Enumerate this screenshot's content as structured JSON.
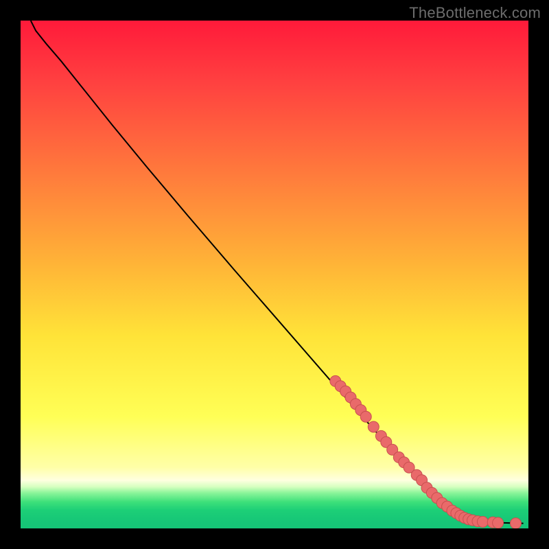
{
  "watermark": "TheBottleneck.com",
  "chart_data": {
    "type": "line",
    "xlim": [
      0,
      100
    ],
    "ylim": [
      0,
      100
    ],
    "grid": false,
    "legend": false,
    "title": "",
    "xlabel": "",
    "ylabel": "",
    "background_gradient_stops": [
      {
        "pos": 0.0,
        "color": "#ff1a3a"
      },
      {
        "pos": 0.12,
        "color": "#ff4040"
      },
      {
        "pos": 0.3,
        "color": "#ff7a3c"
      },
      {
        "pos": 0.48,
        "color": "#ffb437"
      },
      {
        "pos": 0.62,
        "color": "#ffe338"
      },
      {
        "pos": 0.78,
        "color": "#ffff56"
      },
      {
        "pos": 0.88,
        "color": "#ffffa8"
      },
      {
        "pos": 0.905,
        "color": "#ffffe0"
      },
      {
        "pos": 0.918,
        "color": "#d6ffc0"
      },
      {
        "pos": 0.93,
        "color": "#8cf59a"
      },
      {
        "pos": 0.948,
        "color": "#3de07a"
      },
      {
        "pos": 0.964,
        "color": "#1dcf77"
      },
      {
        "pos": 0.982,
        "color": "#17c877"
      },
      {
        "pos": 1.0,
        "color": "#15c577"
      }
    ],
    "curve": [
      {
        "x": 2.0,
        "y": 100.0
      },
      {
        "x": 3.0,
        "y": 98.0
      },
      {
        "x": 5.0,
        "y": 95.5
      },
      {
        "x": 8.0,
        "y": 92.0
      },
      {
        "x": 12.0,
        "y": 87.0
      },
      {
        "x": 18.0,
        "y": 79.5
      },
      {
        "x": 25.0,
        "y": 71.0
      },
      {
        "x": 33.0,
        "y": 61.5
      },
      {
        "x": 42.0,
        "y": 51.0
      },
      {
        "x": 52.0,
        "y": 39.5
      },
      {
        "x": 62.0,
        "y": 28.0
      },
      {
        "x": 70.0,
        "y": 19.0
      },
      {
        "x": 76.0,
        "y": 12.5
      },
      {
        "x": 80.0,
        "y": 8.5
      },
      {
        "x": 83.0,
        "y": 5.5
      },
      {
        "x": 85.5,
        "y": 3.5
      },
      {
        "x": 87.5,
        "y": 2.2
      },
      {
        "x": 89.5,
        "y": 1.5
      },
      {
        "x": 92.0,
        "y": 1.2
      },
      {
        "x": 95.0,
        "y": 1.1
      },
      {
        "x": 99.0,
        "y": 1.0
      }
    ],
    "points": [
      {
        "x": 62.0,
        "y": 29.0
      },
      {
        "x": 63.0,
        "y": 28.0
      },
      {
        "x": 64.0,
        "y": 27.0
      },
      {
        "x": 65.0,
        "y": 25.8
      },
      {
        "x": 66.0,
        "y": 24.5
      },
      {
        "x": 67.0,
        "y": 23.3
      },
      {
        "x": 68.0,
        "y": 22.0
      },
      {
        "x": 69.5,
        "y": 20.0
      },
      {
        "x": 71.0,
        "y": 18.2
      },
      {
        "x": 72.0,
        "y": 17.0
      },
      {
        "x": 73.2,
        "y": 15.5
      },
      {
        "x": 74.5,
        "y": 14.0
      },
      {
        "x": 75.5,
        "y": 13.0
      },
      {
        "x": 76.5,
        "y": 12.0
      },
      {
        "x": 78.0,
        "y": 10.5
      },
      {
        "x": 79.0,
        "y": 9.5
      },
      {
        "x": 80.0,
        "y": 8.0
      },
      {
        "x": 81.0,
        "y": 7.0
      },
      {
        "x": 82.0,
        "y": 6.0
      },
      {
        "x": 83.0,
        "y": 5.0
      },
      {
        "x": 84.0,
        "y": 4.3
      },
      {
        "x": 85.0,
        "y": 3.5
      },
      {
        "x": 85.8,
        "y": 3.0
      },
      {
        "x": 86.6,
        "y": 2.5
      },
      {
        "x": 87.4,
        "y": 2.1
      },
      {
        "x": 88.2,
        "y": 1.8
      },
      {
        "x": 89.0,
        "y": 1.6
      },
      {
        "x": 90.0,
        "y": 1.4
      },
      {
        "x": 91.0,
        "y": 1.3
      },
      {
        "x": 93.0,
        "y": 1.2
      },
      {
        "x": 94.0,
        "y": 1.1
      },
      {
        "x": 97.5,
        "y": 1.0
      }
    ],
    "point_color": "#e96a6a",
    "point_stroke": "#c84f4f",
    "curve_color": "#000000"
  }
}
